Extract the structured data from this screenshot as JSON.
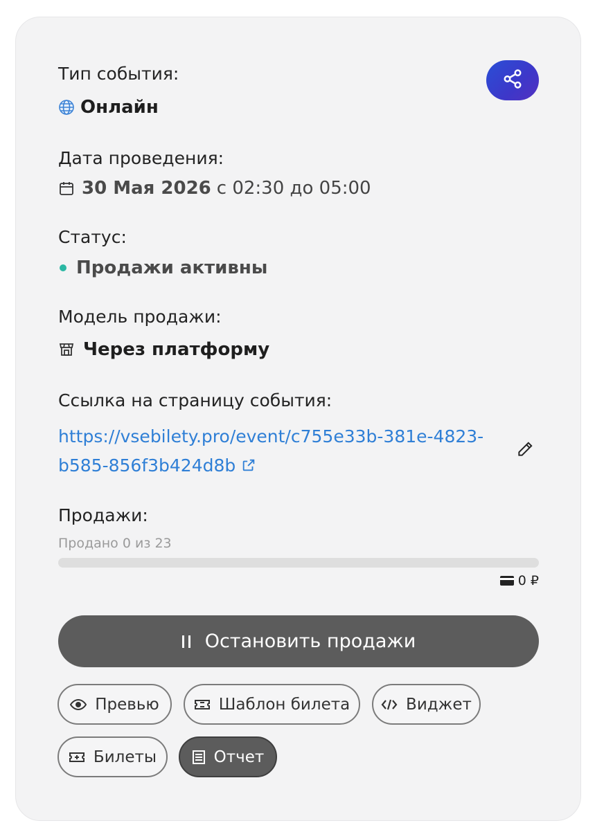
{
  "event_type": {
    "label": "Тип события:",
    "value": "Онлайн"
  },
  "date": {
    "label": "Дата проведения:",
    "date": "30 Мая 2026",
    "time": "с 02:30 до 05:00"
  },
  "status": {
    "label": "Статус:",
    "value": "Продажи активны",
    "color": "#2bb7a3"
  },
  "sales_model": {
    "label": "Модель продажи:",
    "value": "Через платформу"
  },
  "link": {
    "label": "Ссылка на страницу события:",
    "line1": "https://vsebilety.pro/event/c755e33b-381e-4823-",
    "line2": "b585-856f3b424d8b"
  },
  "sales": {
    "label": "Продажи:",
    "sold_text": "Продано 0 из 23",
    "sold": 0,
    "total": 23,
    "progress_fraction": 0,
    "revenue": "0 ₽"
  },
  "stop_button": {
    "label": "Остановить продажи"
  },
  "actions": {
    "preview": "Превью",
    "ticket_template": "Шаблон билета",
    "widget": "Виджет",
    "tickets": "Билеты",
    "report": "Отчет"
  },
  "colors": {
    "accent_link": "#2f7fd6",
    "share_gradient_start": "#2a4fd6",
    "share_gradient_end": "#5331c0",
    "button_dark": "#5c5c5c"
  },
  "icons": [
    "share-icon",
    "globe-icon",
    "calendar-icon",
    "store-icon",
    "external-link-icon",
    "pencil-icon",
    "wallet-icon",
    "pause-icon",
    "eye-icon",
    "ticket-icon",
    "code-icon",
    "ticket-plus-icon",
    "report-icon"
  ]
}
